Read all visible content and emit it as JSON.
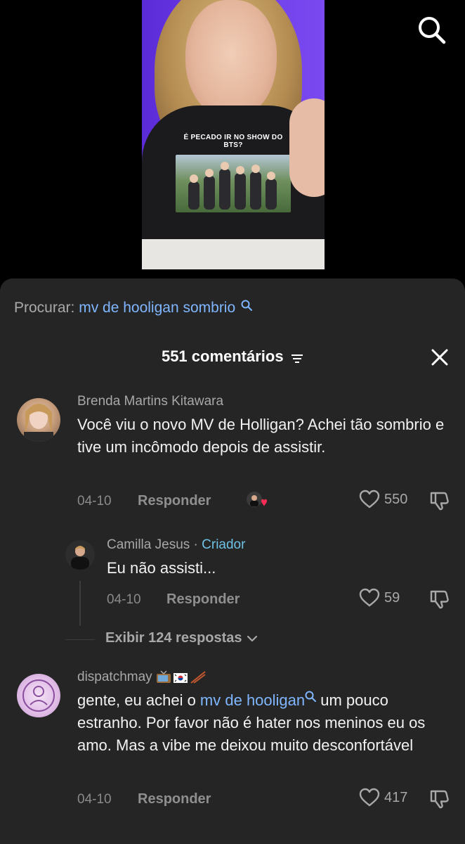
{
  "search": {
    "label": "Procurar:",
    "query": "mv de hooligan sombrio"
  },
  "video": {
    "shirt_text": "É PECADO IR NO SHOW DO BTS?"
  },
  "comments_header": {
    "count_label": "551 comentários"
  },
  "comments": [
    {
      "author": "Brenda Martins Kitawara",
      "text": "Você viu o novo MV de Holligan? Achei tão sombrio e tive um incômodo depois de assistir.",
      "date": "04-10",
      "reply_label": "Responder",
      "likes": "550"
    },
    {
      "author": "Camilla Jesus",
      "separator": " · ",
      "badge": "Criador",
      "text": "Eu não assisti...",
      "date": "04-10",
      "reply_label": "Responder",
      "likes": "59"
    },
    {
      "author": "dispatchmay",
      "text_before": "gente, eu achei o ",
      "text_link": "mv de hooligan",
      "text_after": " um pouco estranho. Por favor não é hater nos meninos eu os amo. Mas a vibe me deixou muito desconfortável",
      "date": "04-10",
      "reply_label": "Responder",
      "likes": "417"
    }
  ],
  "view_replies_label": "Exibir 124 respostas",
  "colors": {
    "sheet_bg": "#252525",
    "link": "#7fb6ff",
    "creator": "#6fc2e6",
    "like_red": "#ff2d55"
  },
  "icons": [
    "search-icon",
    "filter-icon",
    "close-icon",
    "heart-icon",
    "dislike-icon",
    "chevron-down-icon"
  ]
}
